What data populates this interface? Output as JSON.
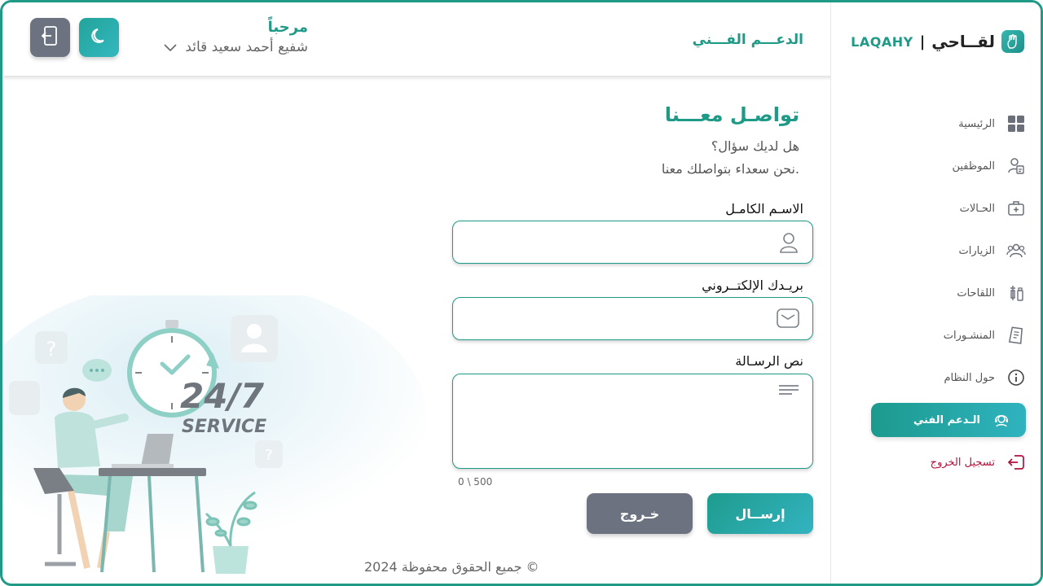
{
  "brand": {
    "name_ar": "لقــاحي",
    "separator": "|",
    "name_en": "LAQAHY"
  },
  "header": {
    "page_heading": "الدعـــم الفـــني",
    "greeting": "مرحباً",
    "user_name": "شفيع أحمد سعيد قائد"
  },
  "sidebar": {
    "items": [
      {
        "label": "الرئيسية",
        "icon": "grid-icon"
      },
      {
        "label": "الموظفين",
        "icon": "employees-icon"
      },
      {
        "label": "الحـالات",
        "icon": "medical-bag-icon"
      },
      {
        "label": "الزيارات",
        "icon": "visitors-icon"
      },
      {
        "label": "اللقاحات",
        "icon": "syringe-icon"
      },
      {
        "label": "المنشـورات",
        "icon": "document-icon"
      },
      {
        "label": "حول النظام",
        "icon": "info-icon"
      },
      {
        "label": "الـدعم الفني",
        "icon": "support-icon",
        "active": true
      },
      {
        "label": "تسجيل الخروج",
        "icon": "logout-icon"
      }
    ]
  },
  "contact": {
    "title": "تواصـل معـــنا",
    "sub1": "هل لديك سؤال؟",
    "sub2": "نحن سعداء بتواصلك معنا.",
    "name_label": "الاسـم الكامـل",
    "email_label": "بريـدك الإلكتــروني",
    "message_label": "نص الرسـالة",
    "counter": "0 \\ 500",
    "send_label": "إرســال",
    "cancel_label": "خـروج"
  },
  "illustration": {
    "line1": "24/7",
    "line2": "SERVICE"
  },
  "footer": "جميع الحقوق محفوظة 2024 ©",
  "colors": {
    "accent": "#1f9a87",
    "accent_light": "#33b3c0",
    "muted_button": "#6d7280",
    "logout": "#b3123d"
  }
}
